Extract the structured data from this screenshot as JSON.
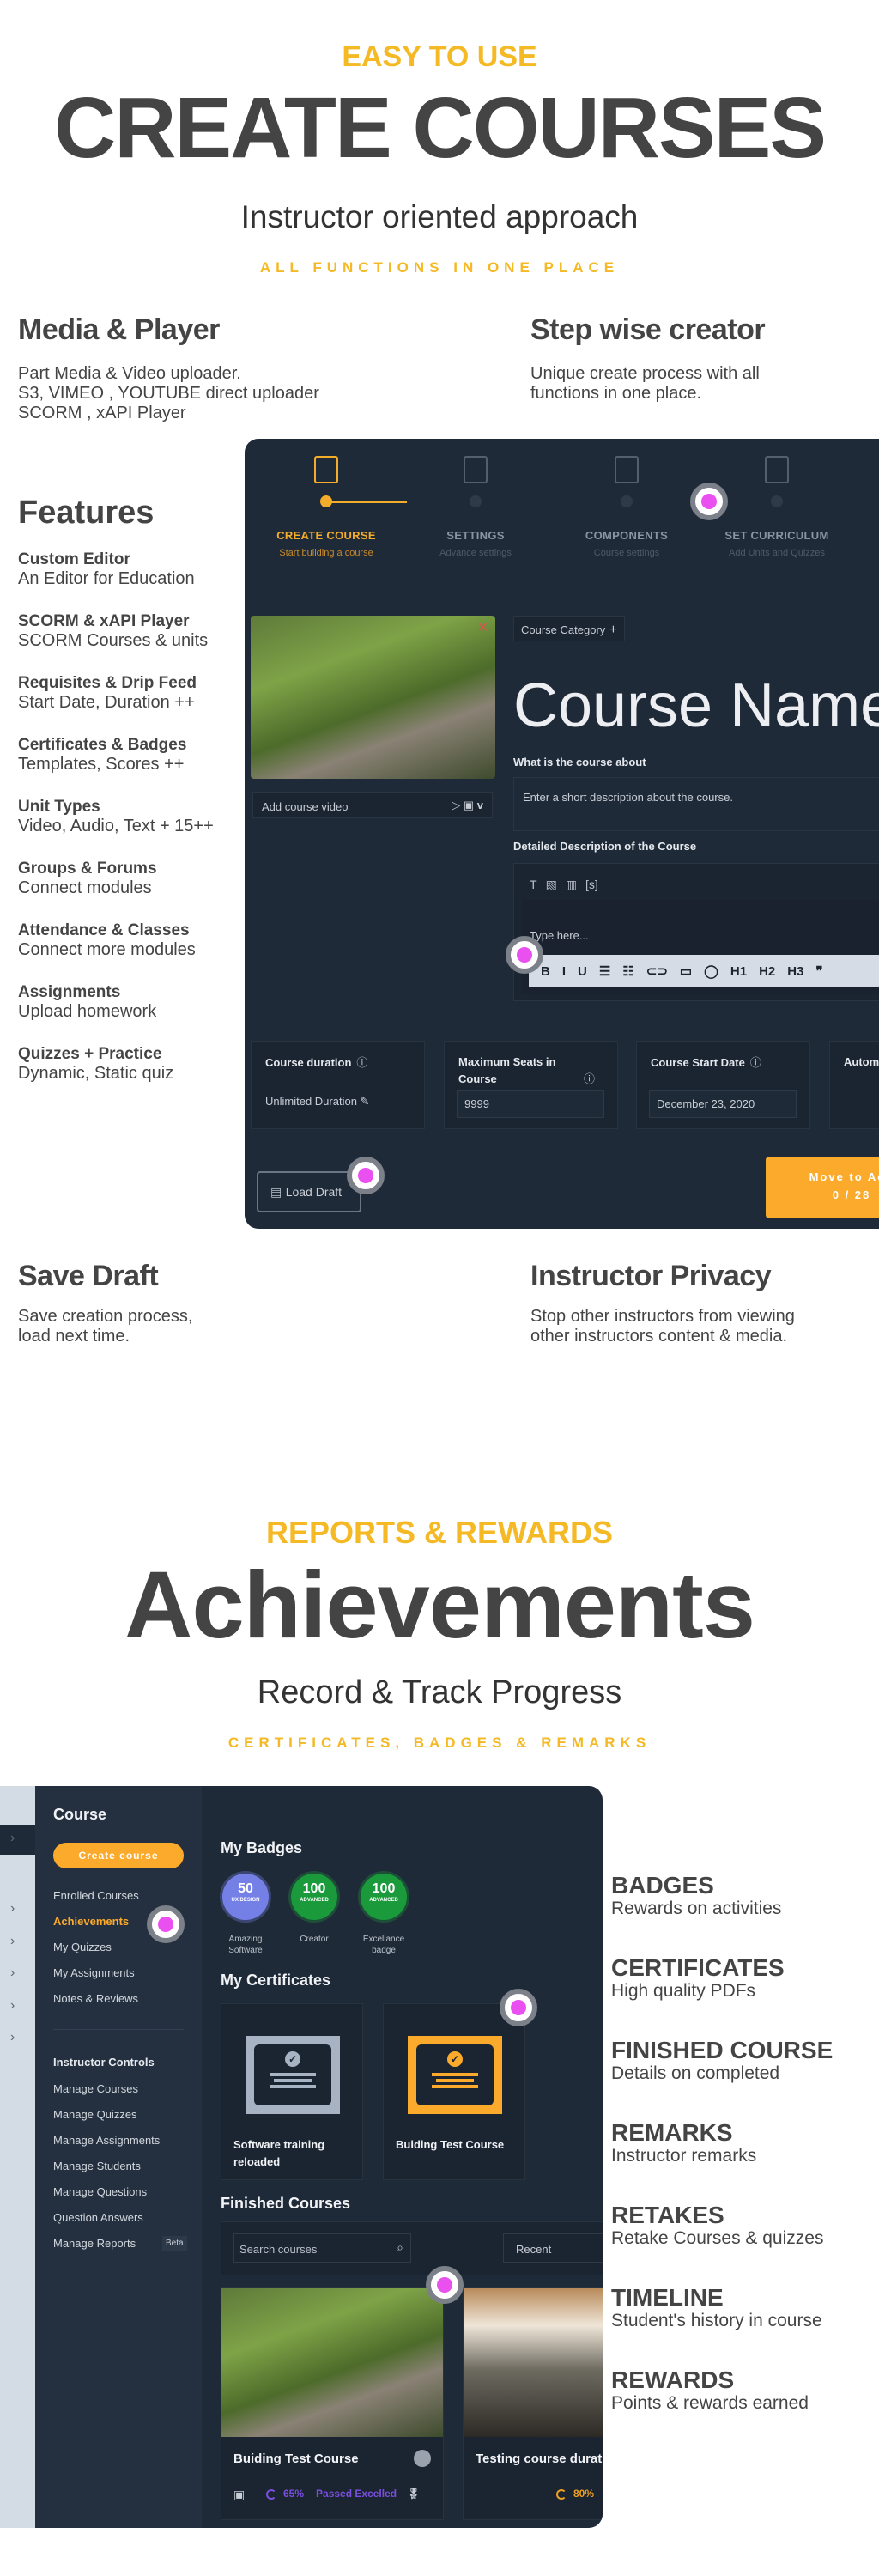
{
  "hero1": {
    "eyebrow": "EASY TO USE",
    "title": "CREATE COURSES",
    "subtitle": "Instructor oriented approach",
    "tagline": "ALL FUNCTIONS IN ONE PLACE"
  },
  "blocks": [
    {
      "title": "Media & Player",
      "lines": [
        "Part Media & Video uploader.",
        "S3, VIMEO , YOUTUBE direct uploader",
        "SCORM , xAPI Player"
      ]
    },
    {
      "title": "Step wise creator",
      "lines": [
        "Unique create process with all",
        "functions in one place."
      ]
    },
    {
      "title": "Save Draft",
      "lines": [
        "Save creation process,",
        "load next time."
      ]
    },
    {
      "title": "Instructor Privacy",
      "lines": [
        "Stop other instructors from viewing",
        "other instructors content & media."
      ]
    }
  ],
  "features": {
    "heading": "Features",
    "items": [
      {
        "title": "Custom Editor",
        "desc": "An Editor for Education"
      },
      {
        "title": "SCORM & xAPI Player",
        "desc": "SCORM Courses & units"
      },
      {
        "title": "Requisites & Drip Feed",
        "desc": "Start Date, Duration ++"
      },
      {
        "title": "Certificates & Badges",
        "desc": "Templates, Scores ++"
      },
      {
        "title": "Unit Types",
        "desc": "Video, Audio, Text + 15++"
      },
      {
        "title": "Groups & Forums",
        "desc": "Connect modules"
      },
      {
        "title": "Attendance & Classes",
        "desc": "Connect more modules"
      },
      {
        "title": "Assignments",
        "desc": "Upload homework"
      },
      {
        "title": "Quizzes  + Practice",
        "desc": "Dynamic, Static quiz"
      }
    ]
  },
  "creator": {
    "steps": [
      {
        "title": "CREATE COURSE",
        "sub": "Start building a course",
        "icon": "bookmark-book-icon",
        "active": true
      },
      {
        "title": "SETTINGS",
        "sub": "Advance settings",
        "icon": "gear-icon"
      },
      {
        "title": "COMPONENTS",
        "sub": "Course settings",
        "icon": "briefcase-icon"
      },
      {
        "title": "SET CURRICULUM",
        "sub": "Add Units and Quizzes",
        "icon": "stacked-pages-icon"
      }
    ],
    "category_label": "Course Category",
    "course_name": "Course Name",
    "about_label": "What is the course about",
    "about_placeholder": "Enter a short description about the course.",
    "video_label": "Add course video",
    "detail_label": "Detailed Description of the Course",
    "editor_placeholder": "Type here...",
    "editor_tools": [
      "T",
      "▧",
      "▥",
      "[s]"
    ],
    "format_tools": [
      "B",
      "I",
      "U",
      "☰",
      "☷",
      "⊂⊃",
      "▭",
      "◯",
      "H1",
      "H2",
      "H3",
      "❞"
    ],
    "cards": [
      {
        "label": "Course duration",
        "value": "Unlimited Duration ✎"
      },
      {
        "label": "Maximum Seats in Course",
        "value": "9999"
      },
      {
        "label": "Course Start Date",
        "value": "December 23, 2020"
      },
      {
        "label": "Autom",
        "value": ""
      }
    ],
    "load_draft": "Load Draft",
    "next_button": "Move to Adv",
    "next_count": "0 / 28",
    "accent": "#fbaa2b",
    "panel_bg": "#1f2a38"
  },
  "hero2": {
    "eyebrow": "REPORTS & REWARDS",
    "title": "Achievements",
    "subtitle": "Record & Track Progress",
    "tagline": "CERTIFICATES, BADGES & REMARKS"
  },
  "dashboard": {
    "sidebar_title": "Course",
    "create_button": "Create course",
    "menu": [
      "Enrolled Courses",
      "Achievements",
      "My Quizzes",
      "My Assignments",
      "Notes & Reviews"
    ],
    "active_menu": "Achievements",
    "instructor_heading": "Instructor Controls",
    "instructor_menu": [
      "Manage Courses",
      "Manage Quizzes",
      "Manage Assignments",
      "Manage Students",
      "Manage Questions",
      "Question Answers",
      "Manage Reports"
    ],
    "beta": "Beta",
    "badges_heading": "My Badges",
    "badges": [
      {
        "num": "50",
        "tag": "UX DESIGN",
        "label": "Amazing Software",
        "color": "#7480e6"
      },
      {
        "num": "100",
        "tag": "ADVANCED",
        "label": "Creator",
        "color": "#1a9a3a"
      },
      {
        "num": "100",
        "tag": "ADVANCED",
        "label": "Excellance badge",
        "color": "#1a9a3a"
      }
    ],
    "certs_heading": "My Certificates",
    "certs": [
      {
        "title": "Software training reloaded",
        "color": "#a7b3c2"
      },
      {
        "title": "Buiding Test Course",
        "color": "#fbaa2b"
      }
    ],
    "finished_heading": "Finished Courses",
    "search_placeholder": "Search courses",
    "sort": "Recent",
    "courses": [
      {
        "title": "Buiding Test Course",
        "progress": "65%",
        "status": "Passed Excelled",
        "color": "#7a4fe0"
      },
      {
        "title": "Testing course durati",
        "progress": "80%",
        "status": "",
        "color": "#f0a020"
      }
    ]
  },
  "rewards": [
    {
      "title": "BADGES",
      "desc": "Rewards on activities"
    },
    {
      "title": "CERTIFICATES",
      "desc": "High quality PDFs"
    },
    {
      "title": "FINISHED COURSE",
      "desc": "Details on completed"
    },
    {
      "title": "REMARKS",
      "desc": "Instructor remarks"
    },
    {
      "title": "RETAKES",
      "desc": "Retake Courses & quizzes"
    },
    {
      "title": "TIMELINE",
      "desc": "Student's history in course"
    },
    {
      "title": "REWARDS",
      "desc": "Points & rewards earned"
    }
  ]
}
